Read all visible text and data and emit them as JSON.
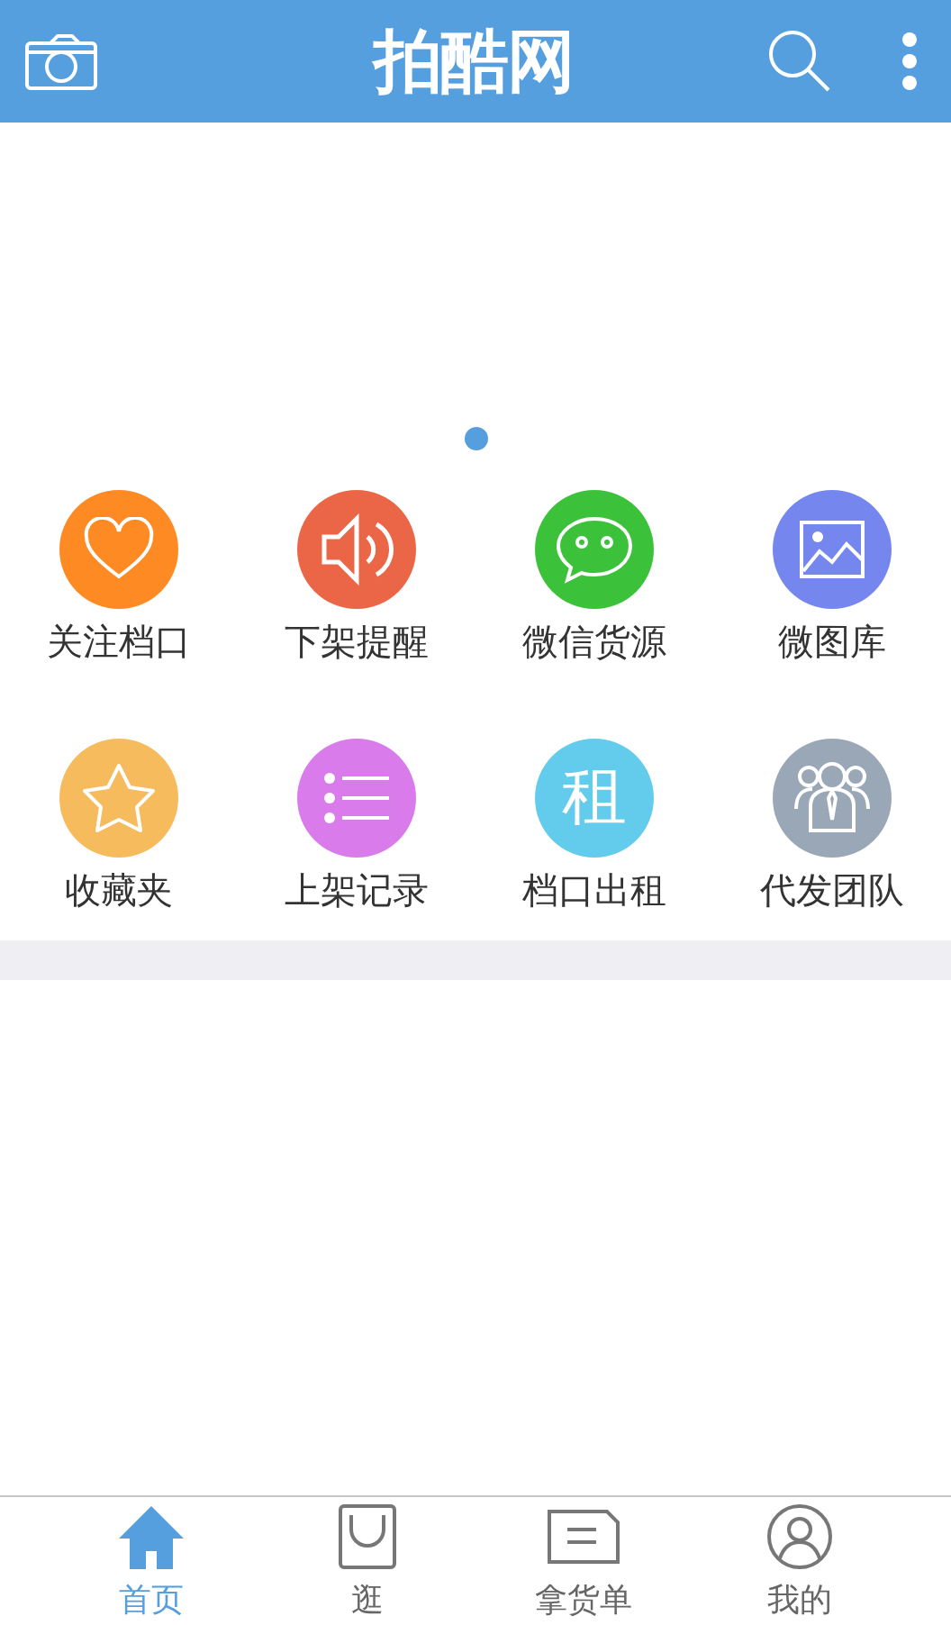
{
  "header": {
    "logo": "拍酷网"
  },
  "carousel": {
    "dots": [
      {
        "selected": true
      }
    ]
  },
  "shortcuts": [
    {
      "label": "关注档口",
      "kind": "heart",
      "color": "#fd8a22"
    },
    {
      "label": "下架提醒",
      "kind": "speaker",
      "color": "#ea6647"
    },
    {
      "label": "微信货源",
      "kind": "chat",
      "color": "#3bc23a"
    },
    {
      "label": "微图库",
      "kind": "image",
      "color": "#7587ee"
    },
    {
      "label": "收藏夹",
      "kind": "star",
      "color": "#f6bb5c"
    },
    {
      "label": "上架记录",
      "kind": "list",
      "color": "#d97bea"
    },
    {
      "label": "档口出租",
      "kind": "glyph",
      "glyph": "租",
      "color": "#63cbec"
    },
    {
      "label": "代发团队",
      "kind": "team",
      "color": "#9aa7b6"
    }
  ],
  "tab_bar": [
    {
      "label": "首页",
      "kind": "home",
      "selected": true
    },
    {
      "label": "逛",
      "kind": "bag",
      "selected": false
    },
    {
      "label": "拿货单",
      "kind": "note",
      "selected": false
    },
    {
      "label": "我的",
      "kind": "user",
      "selected": false
    }
  ]
}
